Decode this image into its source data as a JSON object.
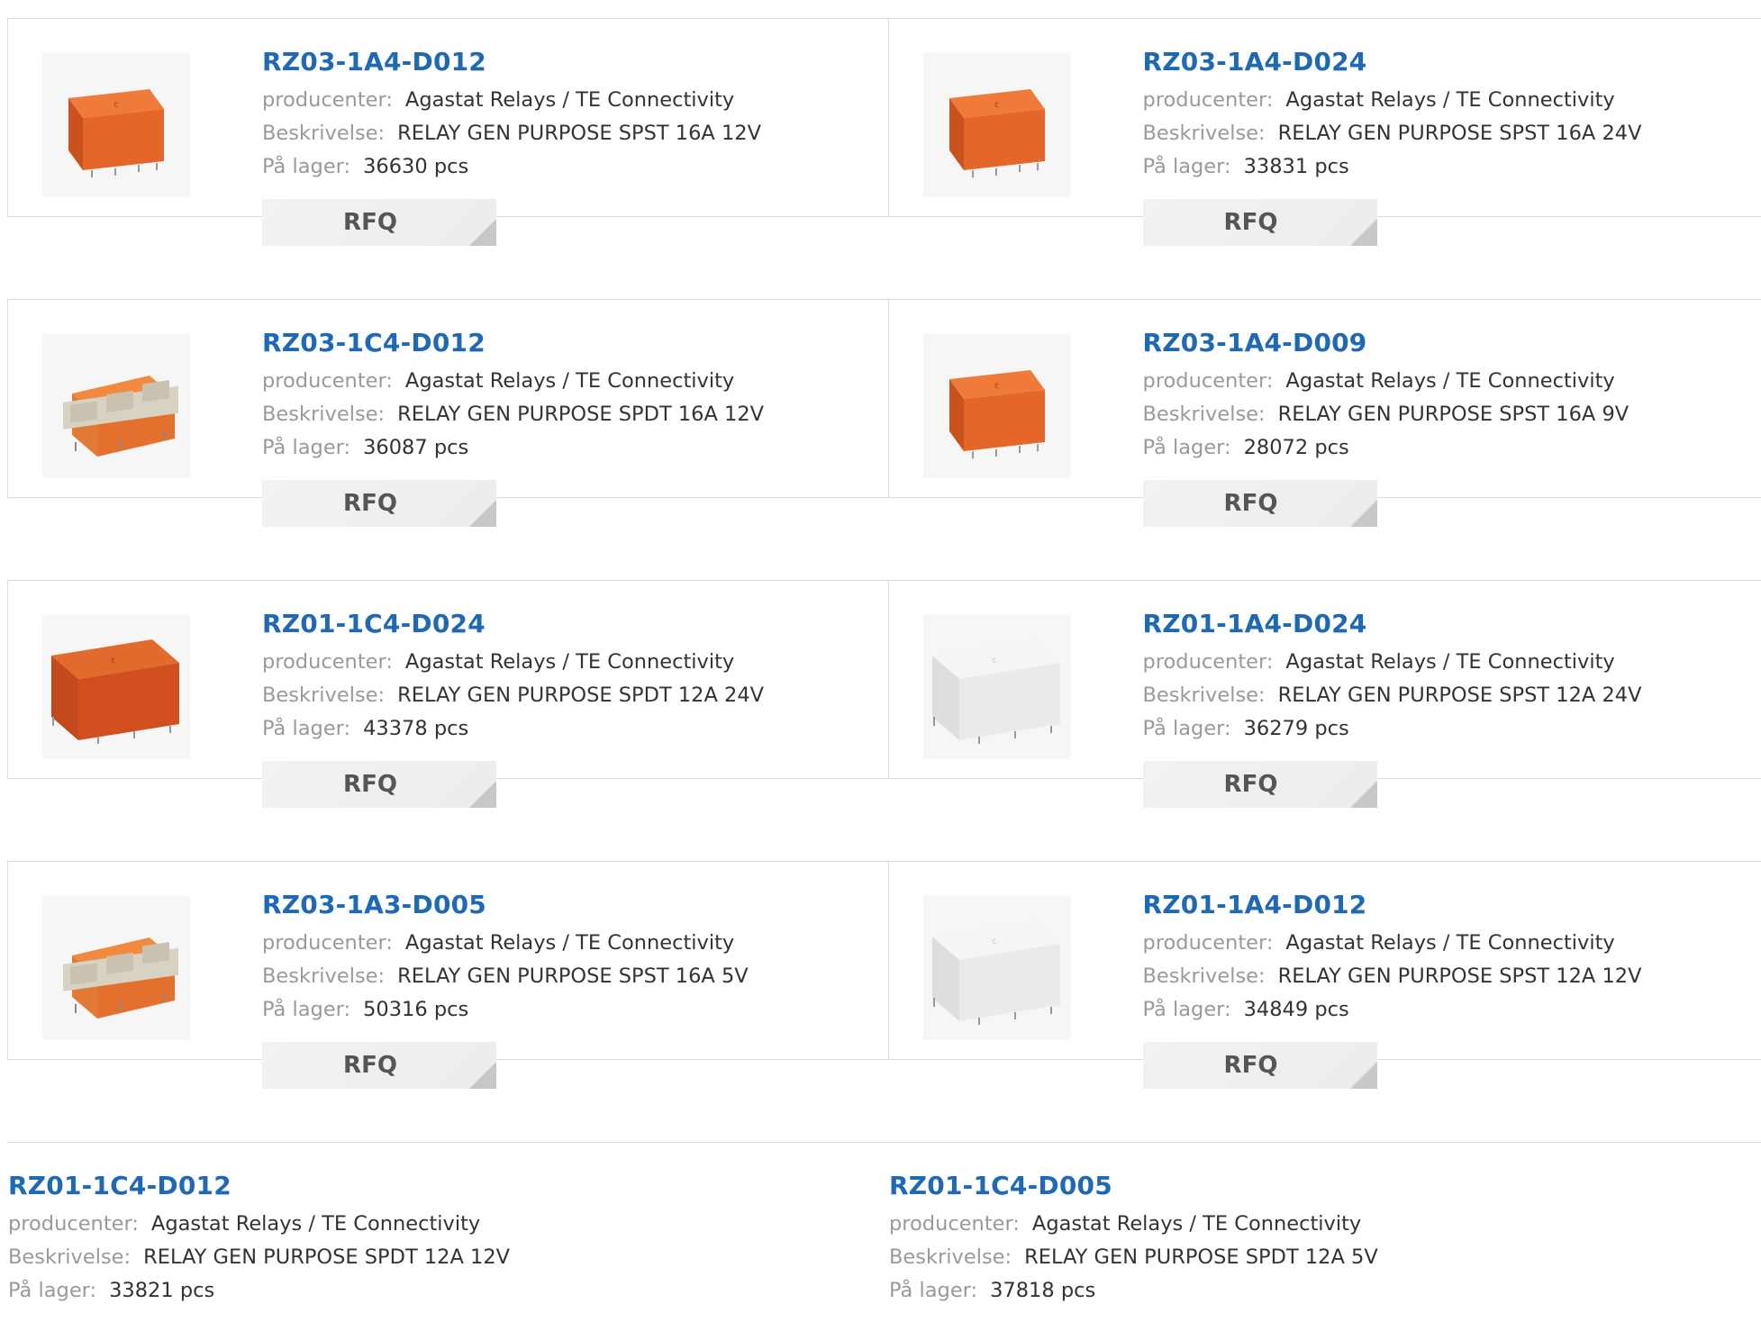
{
  "labels": {
    "manufacturer": "producenter:",
    "description": "Beskrivelse:",
    "stock": "På lager:",
    "rfq": "RFQ"
  },
  "products": [
    {
      "part": "RZ03-1A4-D012",
      "manufacturer": "Agastat Relays / TE Connectivity",
      "description": "RELAY GEN PURPOSE SPST 16A 12V",
      "stock": "36630 pcs",
      "image": "orange-relay-top-icon"
    },
    {
      "part": "RZ03-1A4-D024",
      "manufacturer": "Agastat Relays / TE Connectivity",
      "description": "RELAY GEN PURPOSE SPST 16A 24V",
      "stock": "33831 pcs",
      "image": "orange-relay-top-icon"
    },
    {
      "part": "RZ03-1C4-D012",
      "manufacturer": "Agastat Relays / TE Connectivity",
      "description": "RELAY GEN PURPOSE SPDT 16A 12V",
      "stock": "36087 pcs",
      "image": "orange-relay-open-icon"
    },
    {
      "part": "RZ03-1A4-D009",
      "manufacturer": "Agastat Relays / TE Connectivity",
      "description": "RELAY GEN PURPOSE SPST 16A 9V",
      "stock": "28072 pcs",
      "image": "orange-relay-top-icon"
    },
    {
      "part": "RZ01-1C4-D024",
      "manufacturer": "Agastat Relays / TE Connectivity",
      "description": "RELAY GEN PURPOSE SPDT 12A 24V",
      "stock": "43378 pcs",
      "image": "red-orange-relay-icon"
    },
    {
      "part": "RZ01-1A4-D024",
      "manufacturer": "Agastat Relays / TE Connectivity",
      "description": "RELAY GEN PURPOSE SPST 12A 24V",
      "stock": "36279 pcs",
      "image": "white-relay-icon"
    },
    {
      "part": "RZ03-1A3-D005",
      "manufacturer": "Agastat Relays / TE Connectivity",
      "description": "RELAY GEN PURPOSE SPST 16A 5V",
      "stock": "50316 pcs",
      "image": "orange-relay-open-icon"
    },
    {
      "part": "RZ01-1A4-D012",
      "manufacturer": "Agastat Relays / TE Connectivity",
      "description": "RELAY GEN PURPOSE SPST 12A 12V",
      "stock": "34849 pcs",
      "image": "white-relay-icon"
    },
    {
      "part": "RZ01-1C4-D012",
      "manufacturer": "Agastat Relays / TE Connectivity",
      "description": "RELAY GEN PURPOSE SPDT 12A 12V",
      "stock": "33821 pcs"
    },
    {
      "part": "RZ01-1C4-D005",
      "manufacturer": "Agastat Relays / TE Connectivity",
      "description": "RELAY GEN PURPOSE SPDT 12A 5V",
      "stock": "37818 pcs"
    }
  ],
  "colors": {
    "link": "#1f68b3",
    "label": "#9a9a9a",
    "value": "#333333",
    "border": "#dcdcdc",
    "relay_orange": "#e4662a",
    "relay_red_orange": "#d2501f",
    "relay_white": "#ededed"
  }
}
